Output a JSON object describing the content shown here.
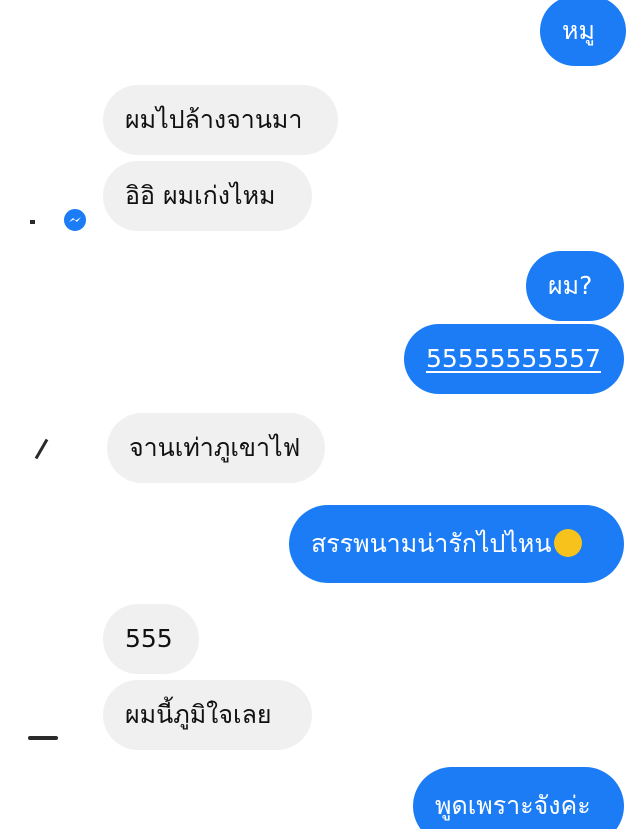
{
  "conversation": {
    "messages": [
      {
        "sender": "me",
        "text": "หมู"
      },
      {
        "sender": "other",
        "text": "ผมไปล้างจานมา"
      },
      {
        "sender": "other",
        "text": "อิอิ ผมเก่งไหม"
      },
      {
        "sender": "me",
        "text": "ผม?"
      },
      {
        "sender": "me",
        "text": "55555555557",
        "style": "link"
      },
      {
        "sender": "other",
        "text": "จานเท่าภูเขาไฟ"
      },
      {
        "sender": "me",
        "text": "สรรพนามน่ารักไปไหน",
        "emoji": "face-with-tears-of-joy"
      },
      {
        "sender": "other",
        "text": "555"
      },
      {
        "sender": "other",
        "text": "ผมนี้ภูมิใจเลย"
      },
      {
        "sender": "me",
        "text": "พูดเพราะจังค่ะ"
      }
    ]
  },
  "colors": {
    "outgoing_bubble": "#1b7cf6",
    "incoming_bubble": "#f1f0f0",
    "outgoing_text": "#ffffff",
    "incoming_text": "#111111"
  },
  "icons": {
    "messenger_badge": "messenger-icon",
    "emoji": "face-with-tears-of-joy-icon"
  }
}
